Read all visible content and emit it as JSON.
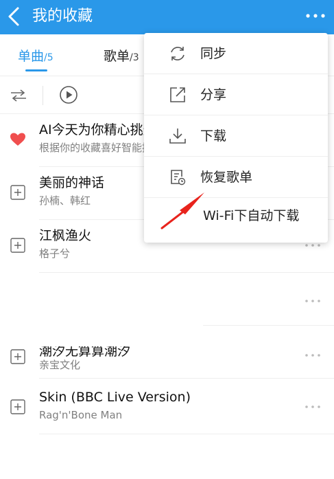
{
  "header": {
    "title": "我的收藏",
    "back_icon": "chevron-left-icon",
    "more_icon": "more-horizontal-icon",
    "bg_color": "#2a98e9"
  },
  "tabs": [
    {
      "label": "单曲",
      "count": "/5",
      "active": true
    },
    {
      "label": "歌单",
      "count": "/3",
      "active": false
    }
  ],
  "toolbar": {
    "shuffle_icon": "shuffle-icon",
    "play_icon": "play-circle-icon"
  },
  "songs": [
    {
      "title": "AI今天为你精心挑选",
      "subtitle": "根据你的收藏喜好智能推荐",
      "lead_icon": "heart-icon"
    },
    {
      "title": "美丽的神话",
      "subtitle": "孙楠、韩红",
      "lead_icon": "add-icon"
    },
    {
      "title": "江枫渔火",
      "subtitle": "格子兮",
      "lead_icon": "add-icon"
    },
    {
      "title": "潮汐无算算潮汐",
      "subtitle": "亲宝文化",
      "lead_icon": "add-icon"
    },
    {
      "title": "Skin (BBC Live Version)",
      "subtitle": "Rag'n'Bone Man",
      "lead_icon": "add-icon"
    }
  ],
  "menu": {
    "items": [
      {
        "label": "同步",
        "icon": "sync-icon"
      },
      {
        "label": "分享",
        "icon": "share-icon"
      },
      {
        "label": "下载",
        "icon": "download-icon"
      },
      {
        "label": "恢复歌单",
        "icon": "restore-playlist-icon"
      },
      {
        "label": "Wi-Fi下自动下载",
        "icon": ""
      }
    ]
  },
  "colors": {
    "accent": "#2a98e9",
    "heart": "#f04e4e",
    "annotation_arrow": "#e8231c"
  }
}
